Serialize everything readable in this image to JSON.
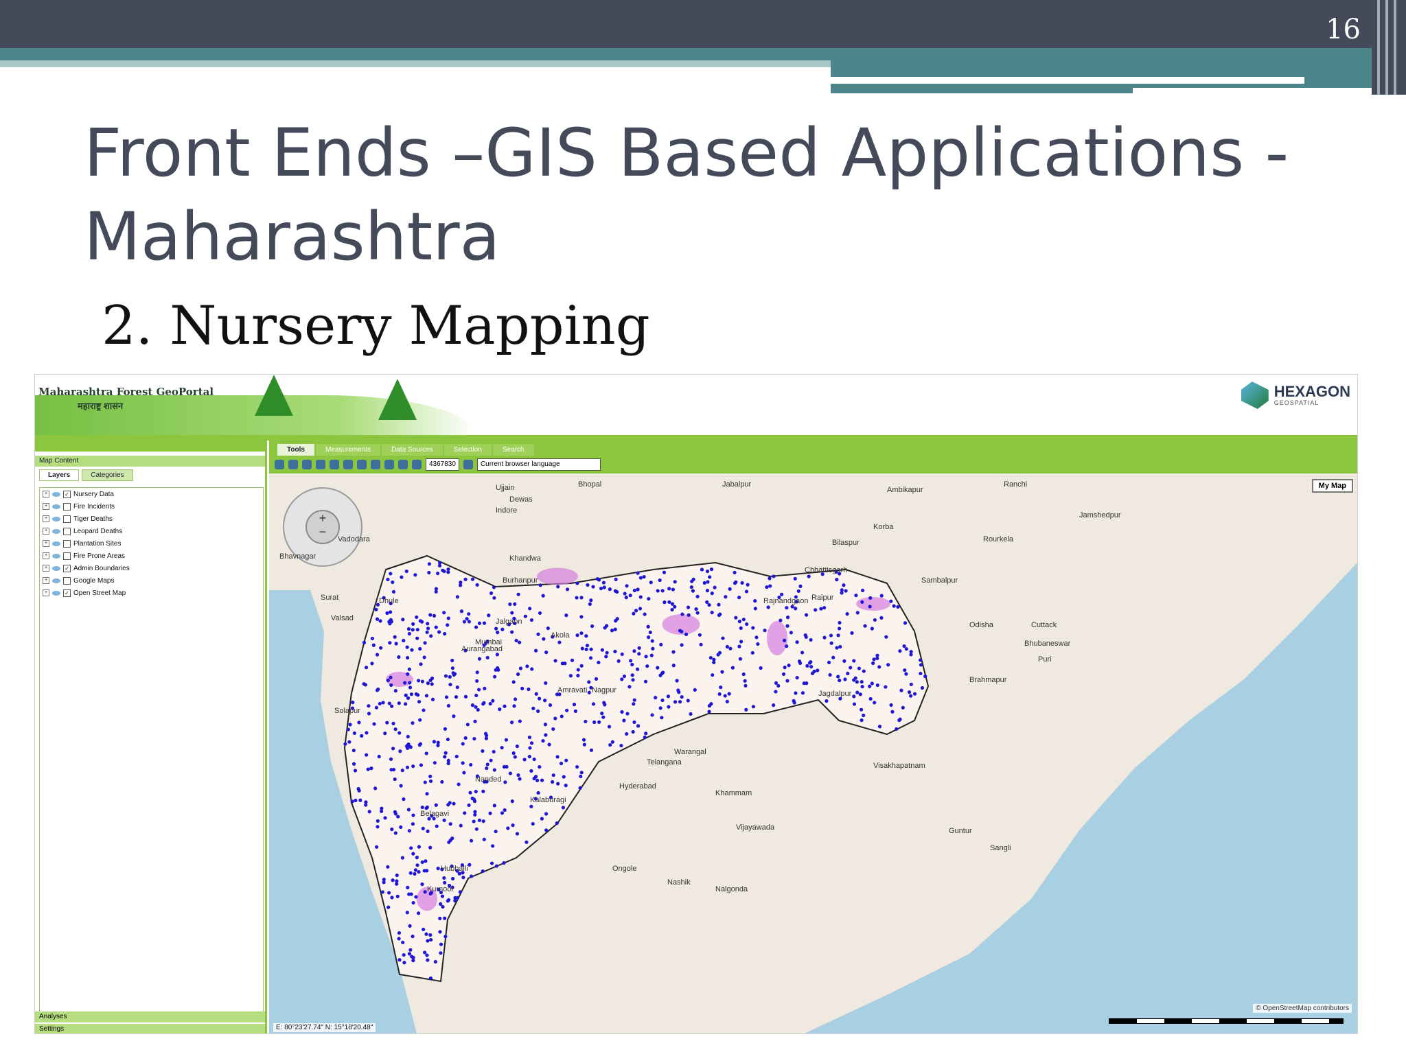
{
  "slide": {
    "number": "16",
    "title": "Front Ends –GIS Based Applications - Maharashtra",
    "subtitle": "2. Nursery Mapping"
  },
  "portal": {
    "title": "Maharashtra Forest GeoPortal",
    "subtitle": "महाराष्ट्र शासन",
    "logo_text": "HEXAGON",
    "logo_sub": "GEOSPATIAL"
  },
  "left_panel": {
    "map_content_label": "Map Content",
    "tabs": [
      "Layers",
      "Categories"
    ],
    "layers": [
      {
        "label": "Nursery Data",
        "checked": true
      },
      {
        "label": "Fire Incidents",
        "checked": false
      },
      {
        "label": "Tiger Deaths",
        "checked": false
      },
      {
        "label": "Leopard Deaths",
        "checked": false
      },
      {
        "label": "Plantation Sites",
        "checked": false
      },
      {
        "label": "Fire Prone Areas",
        "checked": false
      },
      {
        "label": "Admin Boundaries",
        "checked": true
      },
      {
        "label": "Google Maps",
        "checked": false
      },
      {
        "label": "Open Street Map",
        "checked": true
      }
    ],
    "footer_items": [
      "Analyses",
      "Settings"
    ]
  },
  "toolbar": {
    "tabs": [
      "Tools",
      "Measurements",
      "Data Sources",
      "Selection",
      "Search"
    ],
    "scale_value": "4367830",
    "language_value": "Current browser language"
  },
  "map": {
    "my_map_button": "My Map",
    "coords": "E: 80°23'27.74\"   N: 15°18'20.48\"",
    "attribution": "© OpenStreetMap contributors",
    "cities": [
      "Bhopal",
      "Jabalpur",
      "Ujjain",
      "Dewas",
      "Indore",
      "Ranchi",
      "Ambikapur",
      "Jamshedpur",
      "Vadodara",
      "Bhavnagar",
      "Korba",
      "Bilaspur",
      "Rourkela",
      "Khandwa",
      "Chhattisgarh",
      "Burhanpur",
      "Surat",
      "Valsad",
      "Sambalpur",
      "Raipur",
      "Rajnandgaon",
      "Odisha",
      "Cuttack",
      "Bhubaneswar",
      "Puri",
      "Jagdalpur",
      "Brahmapur",
      "Telangana",
      "Warangal",
      "Visakhapatnam",
      "Hyderabad",
      "Kalaburagi",
      "Khammam",
      "Vijayawada",
      "Guntur",
      "Sangli",
      "Belagavi",
      "Hubballi",
      "Kurnool",
      "Ongole",
      "Nalgonda",
      "Nashik",
      "Mumbai",
      "Solapur",
      "Nanded",
      "Amravati",
      "Akola",
      "Jalgaon",
      "Aurangabad",
      "Nagpur",
      "Dhule"
    ]
  },
  "colors": {
    "header_bar": "#454a5b",
    "teal_stripe": "#4c8589",
    "portal_green": "#8cc63f",
    "point_color": "#1f16d8",
    "forest_pink": "#d57de0"
  }
}
